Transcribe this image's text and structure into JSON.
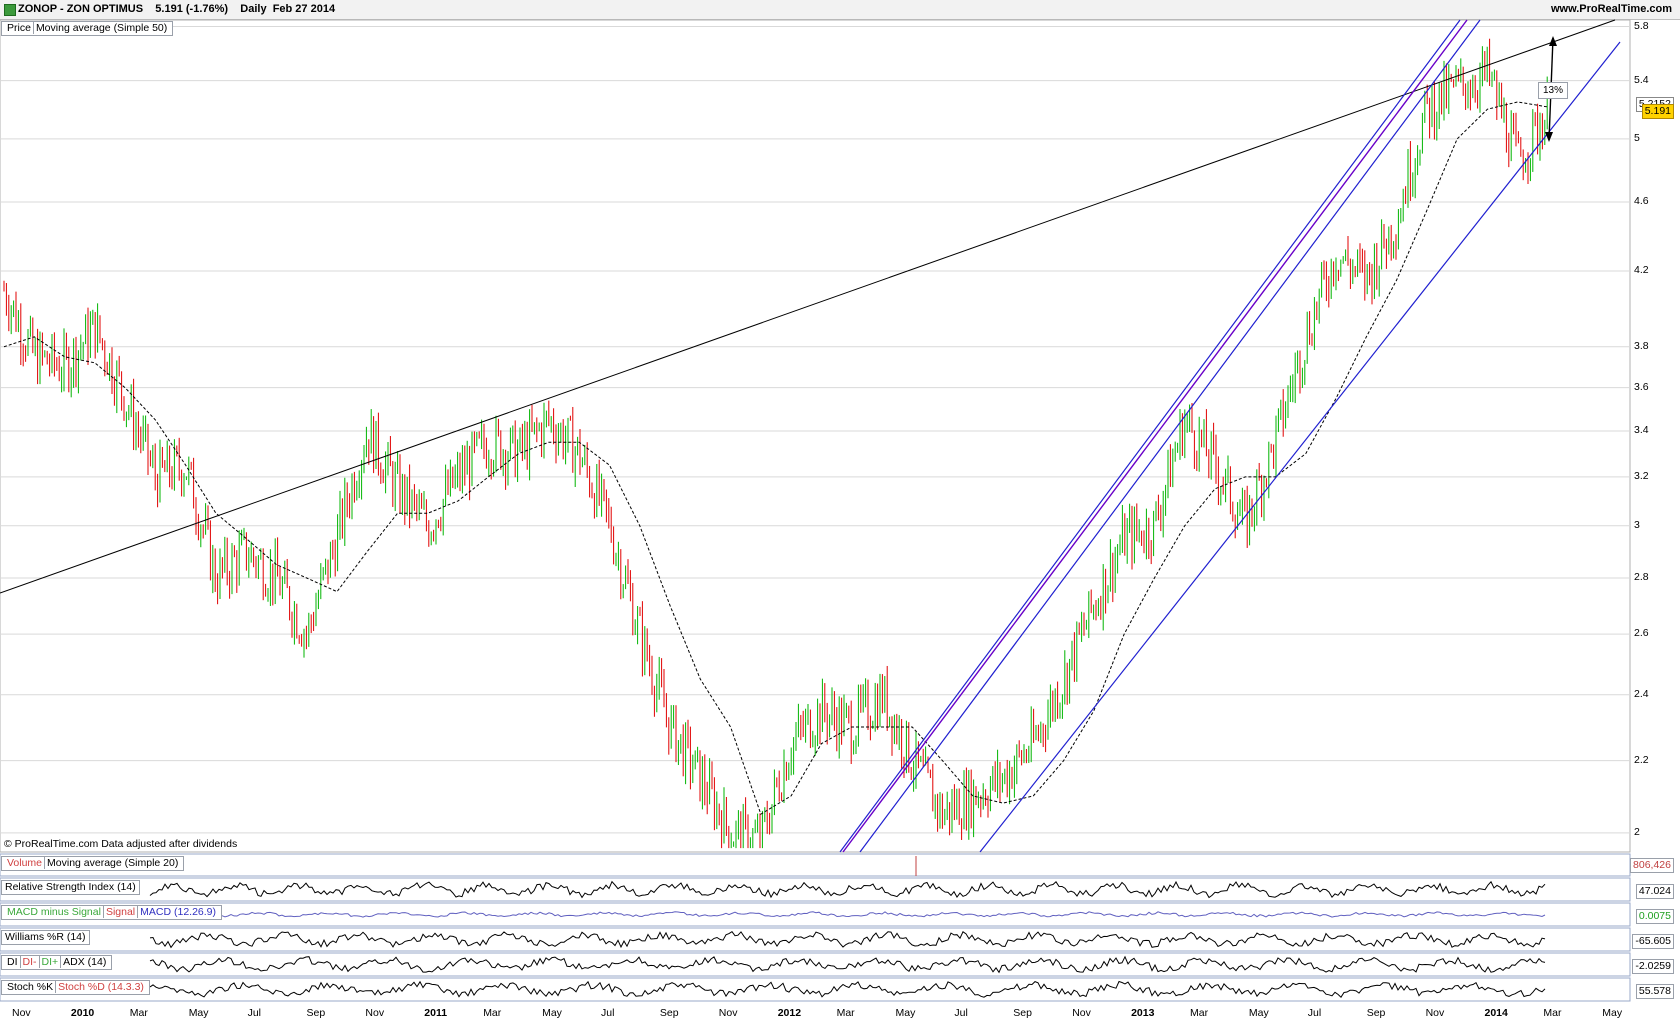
{
  "header": {
    "title": "ZONOP - ZON OPTIMUS    5.191 (-1.76%)    Daily  Feb 27 2014",
    "brand": "www.ProRealTime.com"
  },
  "price_panel": {
    "label_price": "Price",
    "label_ma": "Moving average (Simple 50)",
    "current_price": "5.191",
    "ma_value": "5.2152",
    "pct_annotation": "13%",
    "yticks": [
      "5.8",
      "5.4",
      "5",
      "4.6",
      "4.2",
      "3.8",
      "3.6",
      "3.4",
      "3.2",
      "3",
      "2.8",
      "2.6",
      "2.4",
      "2.2",
      "2"
    ],
    "watermark": "© ProRealTime.com Data adjusted after dividends"
  },
  "indicators": {
    "volume": {
      "label_a": "Volume",
      "label_b": "Moving average (Simple 20)",
      "value": "806,426"
    },
    "rsi": {
      "label": "Relative Strength Index (14)",
      "value": "47.024"
    },
    "macd": {
      "label_a": "MACD minus Signal",
      "label_b": "Signal",
      "label_c": "MACD (12.26.9)",
      "value": "0.0075"
    },
    "williams": {
      "label": "Williams %R (14)",
      "value": "-65.605"
    },
    "dmi": {
      "label_a": "DI",
      "label_b": "DI-",
      "label_c": "DI+",
      "label_d": "ADX (14)",
      "value": "-2.0259"
    },
    "stoch": {
      "label_a": "Stoch %K",
      "label_b": "Stoch %D (14.3.3)",
      "value": "55.578"
    }
  },
  "x_axis": [
    "Nov",
    "2010",
    "Mar",
    "May",
    "Jul",
    "Sep",
    "Nov",
    "2011",
    "Mar",
    "May",
    "Jul",
    "Sep",
    "Nov",
    "2012",
    "Mar",
    "May",
    "Jul",
    "Sep",
    "Nov",
    "2013",
    "Mar",
    "May",
    "Jul",
    "Sep",
    "Nov",
    "2014",
    "Mar",
    "May"
  ],
  "colors": {
    "up": "#00b400",
    "down": "#e00000",
    "trend_black": "#000000",
    "trend_blue": "#2020d0",
    "trend_purple": "#6a00c8",
    "ma": "#000000",
    "grid": "#d9d9d9"
  },
  "chart_data": {
    "type": "line",
    "symbol": "ZONOP",
    "scale": "log",
    "ylim": [
      1.95,
      5.85
    ],
    "x": [
      "2009-11",
      "2009-12",
      "2010-01",
      "2010-02",
      "2010-03",
      "2010-04",
      "2010-05",
      "2010-06",
      "2010-07",
      "2010-08",
      "2010-09",
      "2010-10",
      "2010-11",
      "2010-12",
      "2011-01",
      "2011-02",
      "2011-03",
      "2011-04",
      "2011-05",
      "2011-06",
      "2011-07",
      "2011-08",
      "2011-09",
      "2011-10",
      "2011-11",
      "2011-12",
      "2012-01",
      "2012-02",
      "2012-03",
      "2012-04",
      "2012-05",
      "2012-06",
      "2012-07",
      "2012-08",
      "2012-09",
      "2012-10",
      "2012-11",
      "2012-12",
      "2013-01",
      "2013-02",
      "2013-03",
      "2013-04",
      "2013-05",
      "2013-06",
      "2013-07",
      "2013-08",
      "2013-09",
      "2013-10",
      "2013-11",
      "2013-12",
      "2014-01",
      "2014-02"
    ],
    "series": [
      {
        "values": [
          4.1,
          3.75,
          3.7,
          3.9,
          3.55,
          3.2,
          3.25,
          2.8,
          2.9,
          2.8,
          2.6,
          2.95,
          3.4,
          3.15,
          3.0,
          3.2,
          3.35,
          3.3,
          3.45,
          3.3,
          3.0,
          2.6,
          2.3,
          2.15,
          2.0,
          1.98,
          2.25,
          2.35,
          2.3,
          2.4,
          2.2,
          2.05,
          2.1,
          2.15,
          2.25,
          2.45,
          2.7,
          2.95,
          3.0,
          3.45,
          3.25,
          3.0,
          3.35,
          3.85,
          4.3,
          4.15,
          4.5,
          5.2,
          5.35,
          5.45,
          4.85,
          5.19
        ]
      },
      {
        "values": [
          3.8,
          3.85,
          3.75,
          3.72,
          3.6,
          3.45,
          3.25,
          3.05,
          2.95,
          2.85,
          2.8,
          2.75,
          2.9,
          3.05,
          3.05,
          3.1,
          3.2,
          3.3,
          3.35,
          3.35,
          3.25,
          3.0,
          2.7,
          2.45,
          2.3,
          2.05,
          2.1,
          2.25,
          2.3,
          2.3,
          2.3,
          2.2,
          2.1,
          2.08,
          2.1,
          2.2,
          2.35,
          2.6,
          2.8,
          3.0,
          3.15,
          3.2,
          3.2,
          3.3,
          3.55,
          3.85,
          4.15,
          4.55,
          5.0,
          5.2,
          5.25,
          5.2152
        ]
      }
    ],
    "annotations": [
      "13%"
    ]
  }
}
